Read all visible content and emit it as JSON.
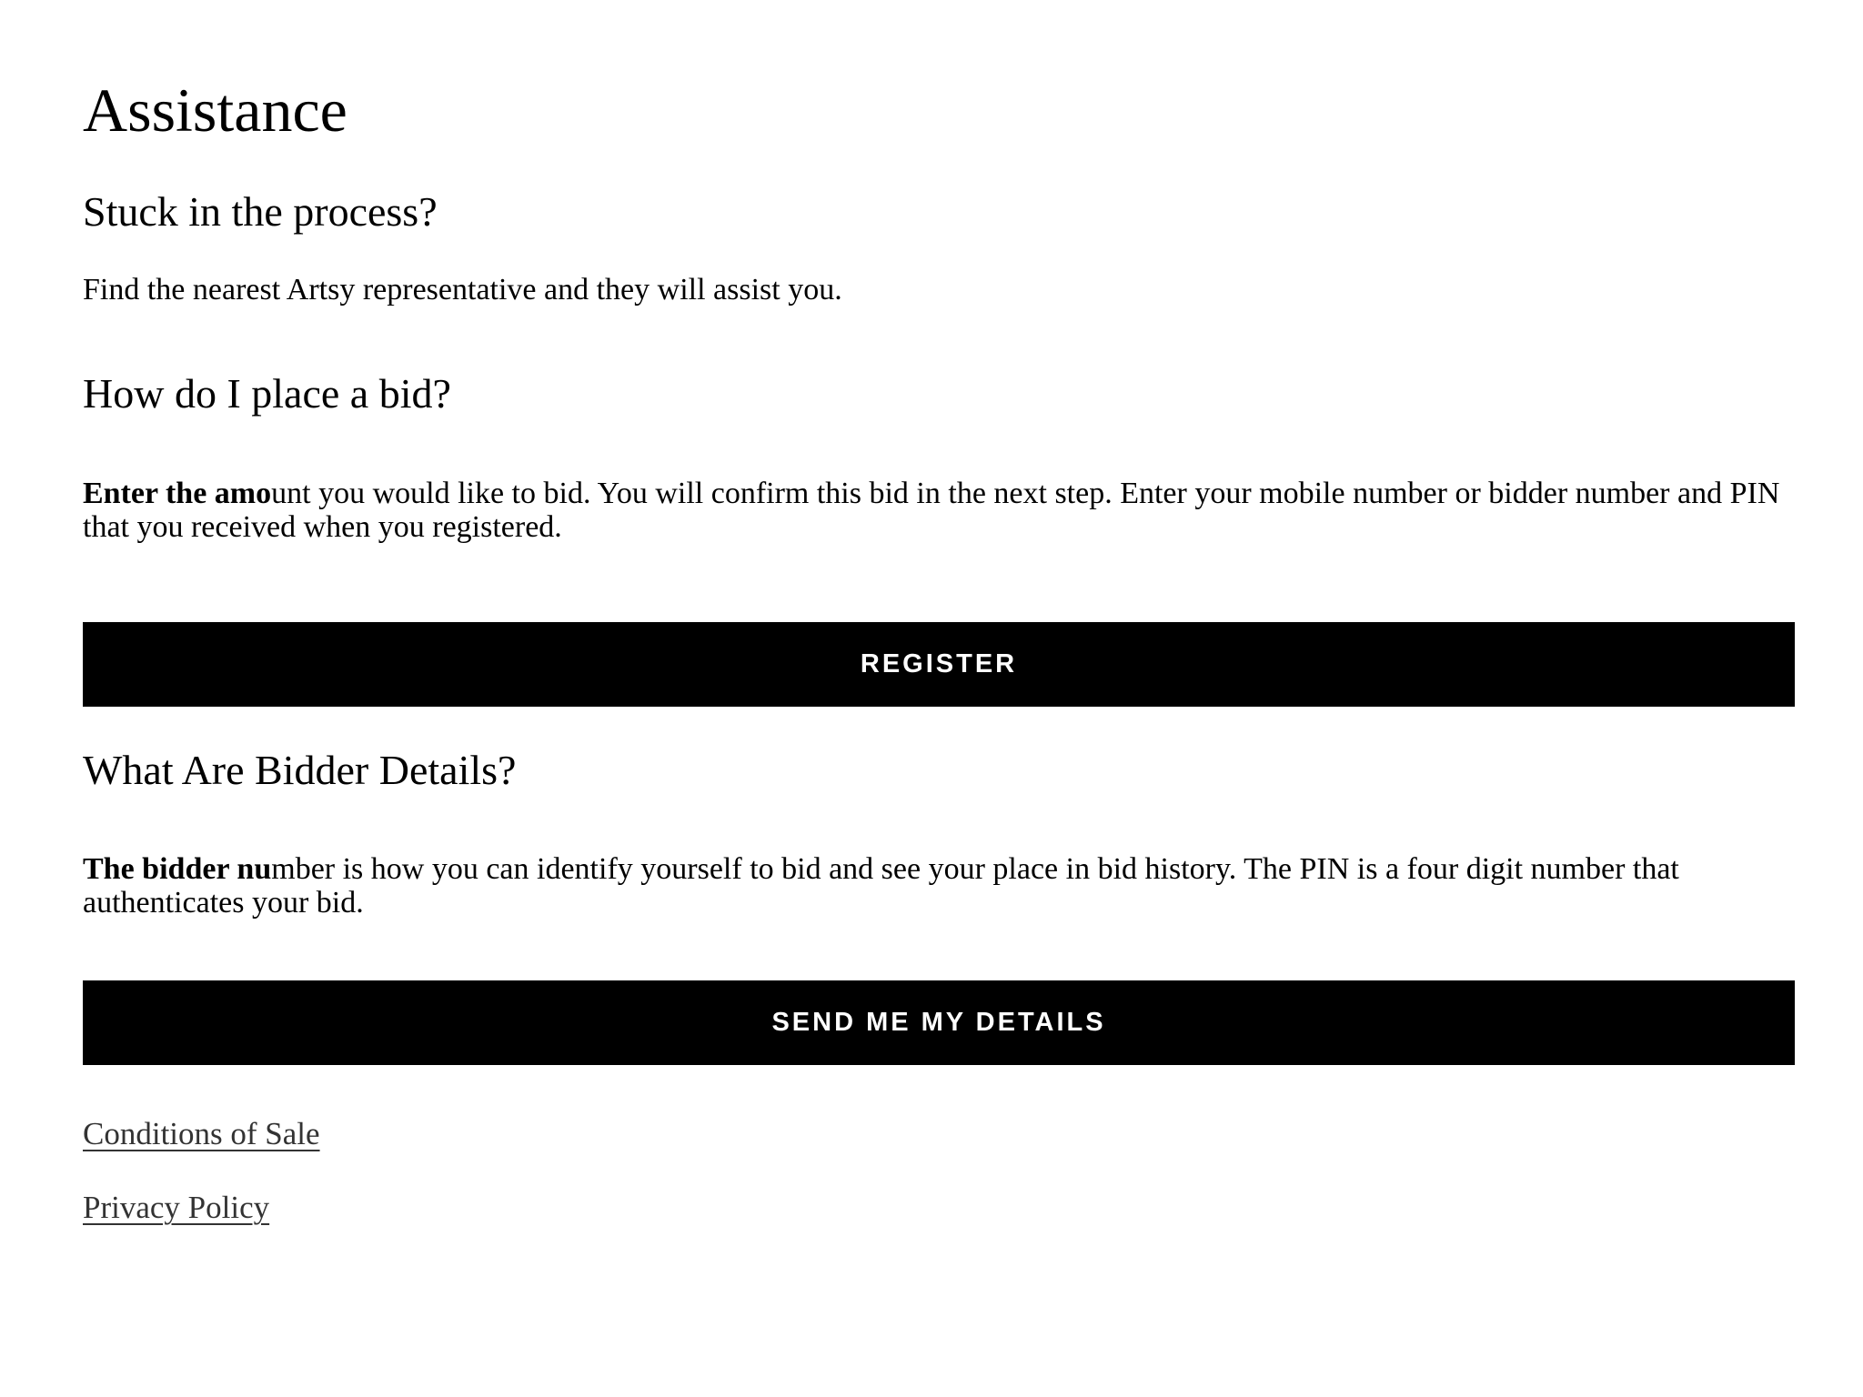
{
  "page": {
    "title": "Assistance"
  },
  "stuck": {
    "heading": "Stuck in the process?",
    "text": "Find the nearest Artsy representative and they will assist you."
  },
  "place_bid": {
    "heading": "How do I place a bid?",
    "text_bold": "Enter the amo",
    "text_rest": "unt you would like to bid. You will confirm this bid in the next step. Enter your mobile number or bidder number and PIN that you received when you registered."
  },
  "register_button": {
    "label": "Register"
  },
  "bidder_details": {
    "heading": "What Are Bidder Details?",
    "text_bold": "The bidder nu",
    "text_rest": "mber is how you can identify yourself to bid and see your place in bid history. The PIN is a four digit number that authenticates your bid."
  },
  "send_button": {
    "label": "Send me my details"
  },
  "footer_links": {
    "conditions": "Conditions of Sale",
    "privacy": "Privacy Policy"
  }
}
